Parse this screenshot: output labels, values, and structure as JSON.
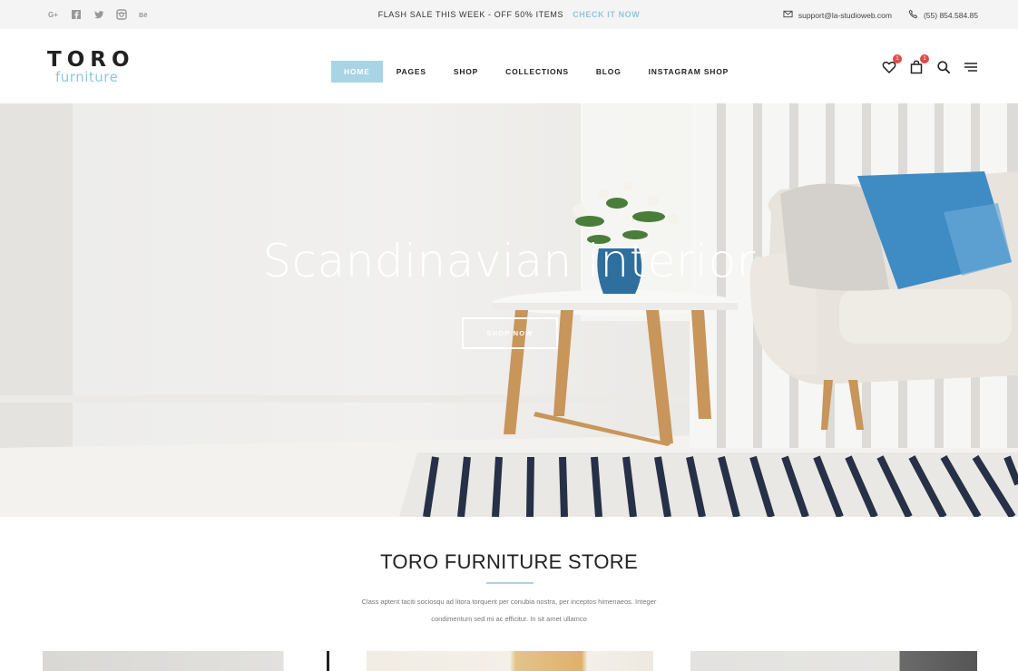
{
  "topbar": {
    "social_icons": [
      "google-plus-icon",
      "facebook-icon",
      "twitter-icon",
      "instagram-icon",
      "behance-icon"
    ],
    "flash_text": "FLASH SALE THIS WEEK - OFF 50% ITEMS",
    "flash_cta": "CHECK IT NOW",
    "email": "support@la-studioweb.com",
    "phone": "(55) 854.584.85"
  },
  "logo": {
    "brand": "TORO",
    "sub": "furniture"
  },
  "nav": {
    "items": [
      {
        "label": "HOME",
        "active": true
      },
      {
        "label": "PAGES"
      },
      {
        "label": "SHOP"
      },
      {
        "label": "COLLECTIONS"
      },
      {
        "label": "BLOG"
      },
      {
        "label": "INSTAGRAM SHOP"
      }
    ]
  },
  "header_icons": {
    "wishlist_count": "1",
    "cart_count": "1"
  },
  "hero": {
    "title": "Scandinavian interior",
    "button": "SHOP NOW"
  },
  "section": {
    "title": "TORO FURNITURE STORE",
    "desc_line1": "Class aptent taciti sociosqu ad litora torquent per conubia nostra, per inceptos himenaeos. Integer",
    "desc_line2": "condimentum sed mi ac efficitur. In sit amet ullamco"
  },
  "colors": {
    "accent": "#a8d4e4",
    "accent_text": "#8fc8dc",
    "badge": "#e14a4a"
  }
}
